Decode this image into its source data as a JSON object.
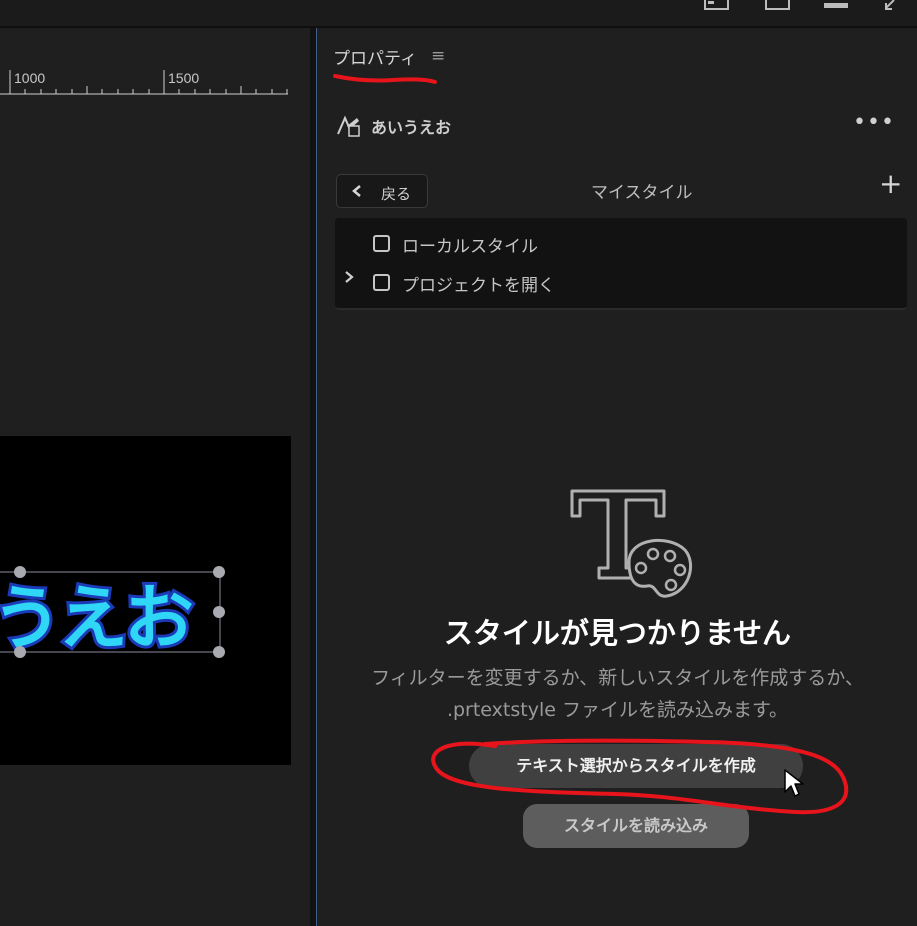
{
  "ruler": {
    "labels": [
      "1000",
      "1500"
    ]
  },
  "canvas": {
    "text": "うえお"
  },
  "panel": {
    "title": "プロパティ",
    "menu_icon": "hamburger-menu-icon",
    "layer": {
      "name": "あいうえお",
      "icon": "text-style-icon"
    },
    "more_icon": "more-horizontal-icon"
  },
  "styles": {
    "back_label": "戻る",
    "section_title": "マイスタイル",
    "add_icon": "plus-icon",
    "items": [
      {
        "label": "ローカルスタイル",
        "expandable": false
      },
      {
        "label": "プロジェクトを開く",
        "expandable": true
      }
    ]
  },
  "empty_state": {
    "icon": "text-palette-icon",
    "title": "スタイルが見つかりません",
    "desc_line1": "フィルターを変更するか、新しいスタイルを作成するか、",
    "desc_line2": ".prtextstyle ファイルを読み込みます。",
    "primary_button": "テキスト選択からスタイルを作成",
    "secondary_button": "スタイルを読み込み"
  },
  "colors": {
    "annotation": "#e8141c",
    "text_fill": "#2fd6f5",
    "text_outline": "#1a3ab8",
    "panel_border": "#3f5f8a"
  }
}
